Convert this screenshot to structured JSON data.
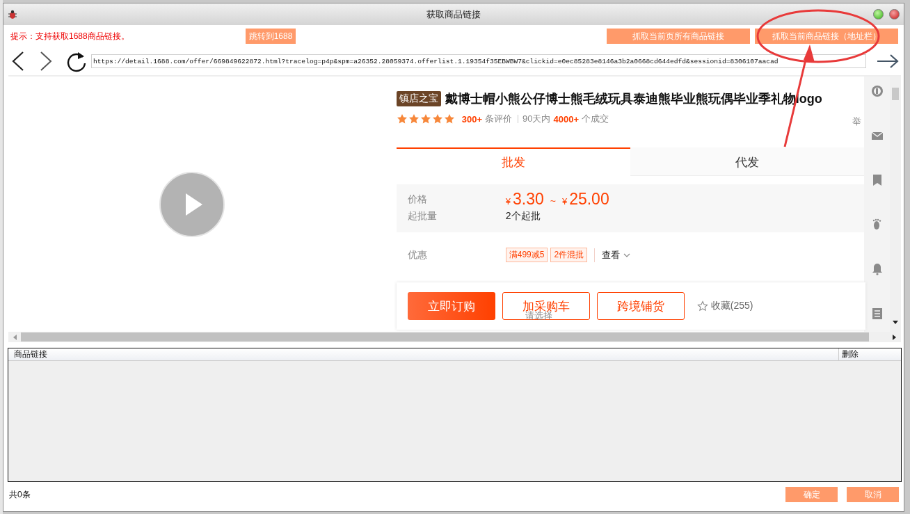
{
  "window": {
    "title": "获取商品链接"
  },
  "toolbar": {
    "hint": "提示：支持获取1688商品链接。",
    "buttons": [
      {
        "label": "跳转到1688"
      },
      {
        "label": "抓取当前页所有商品链接"
      },
      {
        "label": "抓取当前商品链接（地址栏）"
      }
    ]
  },
  "address_bar": {
    "value": "https://detail.1688.com/offer/669849622872.html?tracelog=p4p&spm=a26352.28059374.offerlist.1.19354f35EBWBW7&clickid=e0ec85283e8146a3b2a0668cd644edfd&sessionid=8306107aacad"
  },
  "product": {
    "badge": "镇店之宝",
    "title": "戴博士帽小熊公仔博士熊毛绒玩具泰迪熊毕业熊玩偶毕业季礼物logo",
    "stars": 5,
    "review_count": "300+",
    "review_label": "条评价",
    "period": "90天内",
    "deal_count": "4000+",
    "deal_label": "个成交",
    "report": "举",
    "tabs": [
      {
        "label": "批发",
        "selected": true
      },
      {
        "label": "代发",
        "selected": false
      }
    ],
    "price_label": "价格",
    "price_low_currency": "¥",
    "price_low": "3.30",
    "price_sep": "~",
    "price_high_currency": "¥",
    "price_high": "25.00",
    "moq_label": "起批量",
    "moq_value": "2个起批",
    "promo_label": "优惠",
    "promo_tags": [
      "满499减5",
      "2件混批"
    ],
    "promo_more": "查看",
    "actions": [
      {
        "label": "立即订购",
        "kind": "primary"
      },
      {
        "label": "加采购车",
        "kind": "outline"
      },
      {
        "label": "跨境铺货",
        "kind": "outline"
      }
    ],
    "action_hint": "请选择",
    "favorite": "收藏(255)"
  },
  "links_table": {
    "columns": [
      "商品链接",
      "删除"
    ]
  },
  "footer": {
    "count": "共0条",
    "buttons": [
      "确定",
      "取消"
    ]
  }
}
